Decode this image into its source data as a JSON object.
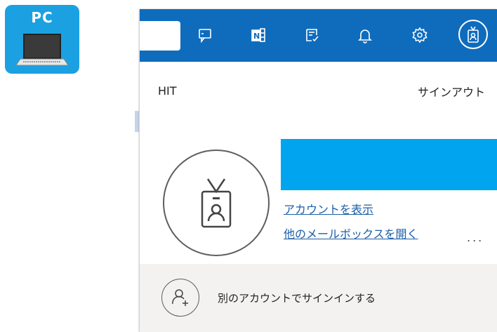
{
  "badge": {
    "label": "PC",
    "icon": "laptop-icon"
  },
  "topbar": {
    "icons": [
      "chat-icon",
      "onenote-icon",
      "checklist-icon",
      "bell-icon",
      "gear-icon",
      "badge-avatar-icon"
    ]
  },
  "account": {
    "org": "HIT",
    "signout": "サインアウト",
    "view_account": "アカウントを表示",
    "open_mailbox": "他のメールボックスを開く",
    "more": "...",
    "add_account": "別のアカウントでサインインする"
  },
  "colors": {
    "topbar": "#0f6cbd",
    "name_bar": "#00a4ef",
    "badge": "#1ba1e2",
    "footer": "#f3f2f1"
  }
}
